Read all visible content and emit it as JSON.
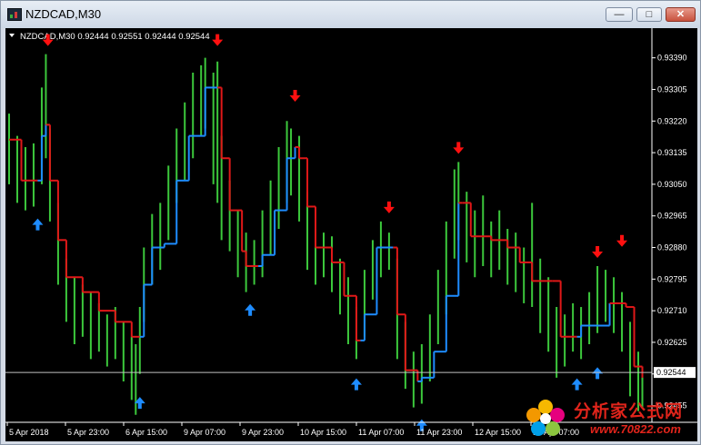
{
  "window": {
    "title": "NZDCAD,M30",
    "min_label": "—",
    "max_label": "□",
    "close_label": "✕"
  },
  "chart_data": {
    "type": "bar",
    "symbol_line": "NZDCAD,M30  0.92444 0.92551 0.92444 0.92544",
    "yticks": [
      "0.93390",
      "0.93305",
      "0.93220",
      "0.93135",
      "0.93050",
      "0.92965",
      "0.92880",
      "0.92795",
      "0.92710",
      "0.92625",
      "0.92540",
      "0.92455"
    ],
    "ylim": [
      0.9241,
      0.9346
    ],
    "current_price_label": "0.92544",
    "current_price": 0.92544,
    "xticks": [
      "5 Apr 2018",
      "5 Apr 23:00",
      "6 Apr 15:00",
      "9 Apr 07:00",
      "9 Apr 23:00",
      "10 Apr 15:00",
      "11 Apr 07:00",
      "11 Apr 23:00",
      "12 Apr 15:00",
      "13 Apr 07:00"
    ],
    "colors": {
      "bars": "#3cc83c",
      "trend_down": "#e01818",
      "trend_up": "#1e8cff",
      "sell_arrow": "#ff1010",
      "buy_arrow": "#1e8cff",
      "axis": "#ffffff",
      "price_line": "#c0c0c0"
    },
    "trend": [
      {
        "x": 0,
        "y": 0.9317,
        "c": "down"
      },
      {
        "x": 3,
        "y": 0.9306,
        "c": "down"
      },
      {
        "x": 7,
        "y": 0.9306,
        "c": "down"
      },
      {
        "x": 8,
        "y": 0.9318,
        "c": "up"
      },
      {
        "x": 9,
        "y": 0.9321,
        "c": "up"
      },
      {
        "x": 10,
        "y": 0.9306,
        "c": "down"
      },
      {
        "x": 12,
        "y": 0.929,
        "c": "down"
      },
      {
        "x": 14,
        "y": 0.928,
        "c": "down"
      },
      {
        "x": 18,
        "y": 0.9276,
        "c": "down"
      },
      {
        "x": 22,
        "y": 0.9271,
        "c": "down"
      },
      {
        "x": 26,
        "y": 0.9268,
        "c": "down"
      },
      {
        "x": 30,
        "y": 0.9264,
        "c": "down"
      },
      {
        "x": 32,
        "y": 0.9264,
        "c": "down"
      },
      {
        "x": 33,
        "y": 0.9278,
        "c": "up"
      },
      {
        "x": 35,
        "y": 0.9288,
        "c": "up"
      },
      {
        "x": 38,
        "y": 0.9289,
        "c": "up"
      },
      {
        "x": 41,
        "y": 0.9306,
        "c": "up"
      },
      {
        "x": 44,
        "y": 0.9318,
        "c": "up"
      },
      {
        "x": 48,
        "y": 0.9331,
        "c": "up"
      },
      {
        "x": 51,
        "y": 0.9331,
        "c": "up"
      },
      {
        "x": 52,
        "y": 0.9312,
        "c": "down"
      },
      {
        "x": 54,
        "y": 0.9298,
        "c": "down"
      },
      {
        "x": 57,
        "y": 0.9287,
        "c": "down"
      },
      {
        "x": 58,
        "y": 0.9283,
        "c": "down"
      },
      {
        "x": 61,
        "y": 0.9283,
        "c": "down"
      },
      {
        "x": 62,
        "y": 0.9286,
        "c": "up"
      },
      {
        "x": 65,
        "y": 0.9298,
        "c": "up"
      },
      {
        "x": 68,
        "y": 0.9312,
        "c": "up"
      },
      {
        "x": 70,
        "y": 0.9315,
        "c": "up"
      },
      {
        "x": 71,
        "y": 0.9312,
        "c": "down"
      },
      {
        "x": 73,
        "y": 0.9299,
        "c": "down"
      },
      {
        "x": 75,
        "y": 0.9288,
        "c": "down"
      },
      {
        "x": 79,
        "y": 0.9284,
        "c": "down"
      },
      {
        "x": 82,
        "y": 0.9275,
        "c": "down"
      },
      {
        "x": 85,
        "y": 0.9263,
        "c": "down"
      },
      {
        "x": 86,
        "y": 0.9263,
        "c": "down"
      },
      {
        "x": 87,
        "y": 0.927,
        "c": "up"
      },
      {
        "x": 90,
        "y": 0.9288,
        "c": "up"
      },
      {
        "x": 94,
        "y": 0.9288,
        "c": "up"
      },
      {
        "x": 95,
        "y": 0.927,
        "c": "down"
      },
      {
        "x": 97,
        "y": 0.9255,
        "c": "down"
      },
      {
        "x": 100,
        "y": 0.9252,
        "c": "down"
      },
      {
        "x": 101,
        "y": 0.9253,
        "c": "up"
      },
      {
        "x": 104,
        "y": 0.926,
        "c": "up"
      },
      {
        "x": 107,
        "y": 0.9275,
        "c": "up"
      },
      {
        "x": 110,
        "y": 0.93,
        "c": "up"
      },
      {
        "x": 111,
        "y": 0.93,
        "c": "down"
      },
      {
        "x": 113,
        "y": 0.9291,
        "c": "down"
      },
      {
        "x": 118,
        "y": 0.929,
        "c": "down"
      },
      {
        "x": 122,
        "y": 0.9288,
        "c": "down"
      },
      {
        "x": 125,
        "y": 0.9284,
        "c": "down"
      },
      {
        "x": 128,
        "y": 0.9279,
        "c": "down"
      },
      {
        "x": 133,
        "y": 0.9279,
        "c": "down"
      },
      {
        "x": 135,
        "y": 0.9264,
        "c": "down"
      },
      {
        "x": 139,
        "y": 0.9264,
        "c": "down"
      },
      {
        "x": 140,
        "y": 0.9267,
        "c": "up"
      },
      {
        "x": 144,
        "y": 0.9267,
        "c": "up"
      },
      {
        "x": 147,
        "y": 0.9273,
        "c": "up"
      },
      {
        "x": 148,
        "y": 0.9273,
        "c": "down"
      },
      {
        "x": 151,
        "y": 0.9272,
        "c": "down"
      },
      {
        "x": 153,
        "y": 0.9256,
        "c": "down"
      },
      {
        "x": 155,
        "y": 0.9253,
        "c": "down"
      }
    ],
    "bars": [
      {
        "x": 0,
        "lo": 0.9305,
        "hi": 0.9324
      },
      {
        "x": 2,
        "lo": 0.93,
        "hi": 0.9318
      },
      {
        "x": 4,
        "lo": 0.9298,
        "hi": 0.9315
      },
      {
        "x": 6,
        "lo": 0.9299,
        "hi": 0.9316
      },
      {
        "x": 8,
        "lo": 0.9305,
        "hi": 0.9331
      },
      {
        "x": 9,
        "lo": 0.9312,
        "hi": 0.934
      },
      {
        "x": 10,
        "lo": 0.9295,
        "hi": 0.932
      },
      {
        "x": 12,
        "lo": 0.9278,
        "hi": 0.93
      },
      {
        "x": 14,
        "lo": 0.9268,
        "hi": 0.9285
      },
      {
        "x": 16,
        "lo": 0.9262,
        "hi": 0.928
      },
      {
        "x": 18,
        "lo": 0.9264,
        "hi": 0.9278
      },
      {
        "x": 20,
        "lo": 0.9258,
        "hi": 0.9276
      },
      {
        "x": 22,
        "lo": 0.926,
        "hi": 0.9273
      },
      {
        "x": 24,
        "lo": 0.9256,
        "hi": 0.927
      },
      {
        "x": 26,
        "lo": 0.9258,
        "hi": 0.9272
      },
      {
        "x": 28,
        "lo": 0.9252,
        "hi": 0.9268
      },
      {
        "x": 30,
        "lo": 0.9247,
        "hi": 0.9264
      },
      {
        "x": 31,
        "lo": 0.9243,
        "hi": 0.9262
      },
      {
        "x": 32,
        "lo": 0.9254,
        "hi": 0.9272
      },
      {
        "x": 33,
        "lo": 0.9268,
        "hi": 0.9288
      },
      {
        "x": 35,
        "lo": 0.9278,
        "hi": 0.9297
      },
      {
        "x": 37,
        "lo": 0.9282,
        "hi": 0.93
      },
      {
        "x": 39,
        "lo": 0.929,
        "hi": 0.931
      },
      {
        "x": 41,
        "lo": 0.93,
        "hi": 0.932
      },
      {
        "x": 43,
        "lo": 0.9306,
        "hi": 0.9327
      },
      {
        "x": 45,
        "lo": 0.9312,
        "hi": 0.9335
      },
      {
        "x": 47,
        "lo": 0.9318,
        "hi": 0.9337
      },
      {
        "x": 48,
        "lo": 0.932,
        "hi": 0.9339
      },
      {
        "x": 50,
        "lo": 0.9305,
        "hi": 0.9335
      },
      {
        "x": 51,
        "lo": 0.93,
        "hi": 0.9338
      },
      {
        "x": 52,
        "lo": 0.929,
        "hi": 0.9318
      },
      {
        "x": 54,
        "lo": 0.9287,
        "hi": 0.9306
      },
      {
        "x": 56,
        "lo": 0.928,
        "hi": 0.9298
      },
      {
        "x": 58,
        "lo": 0.9276,
        "hi": 0.9292
      },
      {
        "x": 60,
        "lo": 0.9278,
        "hi": 0.929
      },
      {
        "x": 62,
        "lo": 0.928,
        "hi": 0.9298
      },
      {
        "x": 64,
        "lo": 0.9286,
        "hi": 0.9306
      },
      {
        "x": 66,
        "lo": 0.9293,
        "hi": 0.9315
      },
      {
        "x": 68,
        "lo": 0.93,
        "hi": 0.9322
      },
      {
        "x": 69,
        "lo": 0.9302,
        "hi": 0.932
      },
      {
        "x": 71,
        "lo": 0.9295,
        "hi": 0.9318
      },
      {
        "x": 73,
        "lo": 0.9282,
        "hi": 0.9303
      },
      {
        "x": 75,
        "lo": 0.9278,
        "hi": 0.9293
      },
      {
        "x": 77,
        "lo": 0.928,
        "hi": 0.9292
      },
      {
        "x": 79,
        "lo": 0.9276,
        "hi": 0.9291
      },
      {
        "x": 81,
        "lo": 0.927,
        "hi": 0.9285
      },
      {
        "x": 83,
        "lo": 0.9262,
        "hi": 0.928
      },
      {
        "x": 85,
        "lo": 0.9258,
        "hi": 0.9272
      },
      {
        "x": 87,
        "lo": 0.9264,
        "hi": 0.9282
      },
      {
        "x": 89,
        "lo": 0.9274,
        "hi": 0.929
      },
      {
        "x": 91,
        "lo": 0.928,
        "hi": 0.9295
      },
      {
        "x": 93,
        "lo": 0.9282,
        "hi": 0.9292
      },
      {
        "x": 95,
        "lo": 0.9258,
        "hi": 0.9285
      },
      {
        "x": 97,
        "lo": 0.925,
        "hi": 0.9268
      },
      {
        "x": 99,
        "lo": 0.9245,
        "hi": 0.926
      },
      {
        "x": 101,
        "lo": 0.9246,
        "hi": 0.9262
      },
      {
        "x": 103,
        "lo": 0.9252,
        "hi": 0.927
      },
      {
        "x": 105,
        "lo": 0.9262,
        "hi": 0.9282
      },
      {
        "x": 107,
        "lo": 0.927,
        "hi": 0.9295
      },
      {
        "x": 109,
        "lo": 0.9285,
        "hi": 0.9309
      },
      {
        "x": 110,
        "lo": 0.929,
        "hi": 0.9311
      },
      {
        "x": 112,
        "lo": 0.9284,
        "hi": 0.9303
      },
      {
        "x": 114,
        "lo": 0.928,
        "hi": 0.9298
      },
      {
        "x": 116,
        "lo": 0.9283,
        "hi": 0.9302
      },
      {
        "x": 118,
        "lo": 0.928,
        "hi": 0.9295
      },
      {
        "x": 120,
        "lo": 0.9282,
        "hi": 0.9298
      },
      {
        "x": 122,
        "lo": 0.9278,
        "hi": 0.9293
      },
      {
        "x": 124,
        "lo": 0.9276,
        "hi": 0.9292
      },
      {
        "x": 126,
        "lo": 0.9273,
        "hi": 0.9288
      },
      {
        "x": 128,
        "lo": 0.9272,
        "hi": 0.93
      },
      {
        "x": 130,
        "lo": 0.9265,
        "hi": 0.9285
      },
      {
        "x": 132,
        "lo": 0.926,
        "hi": 0.928
      },
      {
        "x": 134,
        "lo": 0.9253,
        "hi": 0.9272
      },
      {
        "x": 136,
        "lo": 0.9256,
        "hi": 0.927
      },
      {
        "x": 138,
        "lo": 0.926,
        "hi": 0.9273
      },
      {
        "x": 140,
        "lo": 0.9258,
        "hi": 0.9272
      },
      {
        "x": 142,
        "lo": 0.9262,
        "hi": 0.9276
      },
      {
        "x": 144,
        "lo": 0.9265,
        "hi": 0.9283
      },
      {
        "x": 146,
        "lo": 0.9268,
        "hi": 0.9282
      },
      {
        "x": 148,
        "lo": 0.9265,
        "hi": 0.928
      },
      {
        "x": 150,
        "lo": 0.926,
        "hi": 0.9276
      },
      {
        "x": 152,
        "lo": 0.9248,
        "hi": 0.9268
      },
      {
        "x": 154,
        "lo": 0.9244,
        "hi": 0.926
      },
      {
        "x": 155,
        "lo": 0.9245,
        "hi": 0.9256
      }
    ],
    "sell_arrows": [
      {
        "x": 9.5,
        "price": 0.934
      },
      {
        "x": 51,
        "price": 0.934
      },
      {
        "x": 70,
        "price": 0.9325
      },
      {
        "x": 93,
        "price": 0.9295
      },
      {
        "x": 110,
        "price": 0.9311
      },
      {
        "x": 144,
        "price": 0.9283
      },
      {
        "x": 150,
        "price": 0.9286
      }
    ],
    "buy_arrows": [
      {
        "x": 7,
        "price": 0.9298
      },
      {
        "x": 32,
        "price": 0.925
      },
      {
        "x": 59,
        "price": 0.9275
      },
      {
        "x": 85,
        "price": 0.9255
      },
      {
        "x": 101,
        "price": 0.9244
      },
      {
        "x": 139,
        "price": 0.9255
      },
      {
        "x": 144,
        "price": 0.9258
      }
    ],
    "x_range": [
      0,
      156
    ]
  },
  "watermark": {
    "text_cn": "分析家公式网",
    "text_url": "www.70822.com"
  }
}
